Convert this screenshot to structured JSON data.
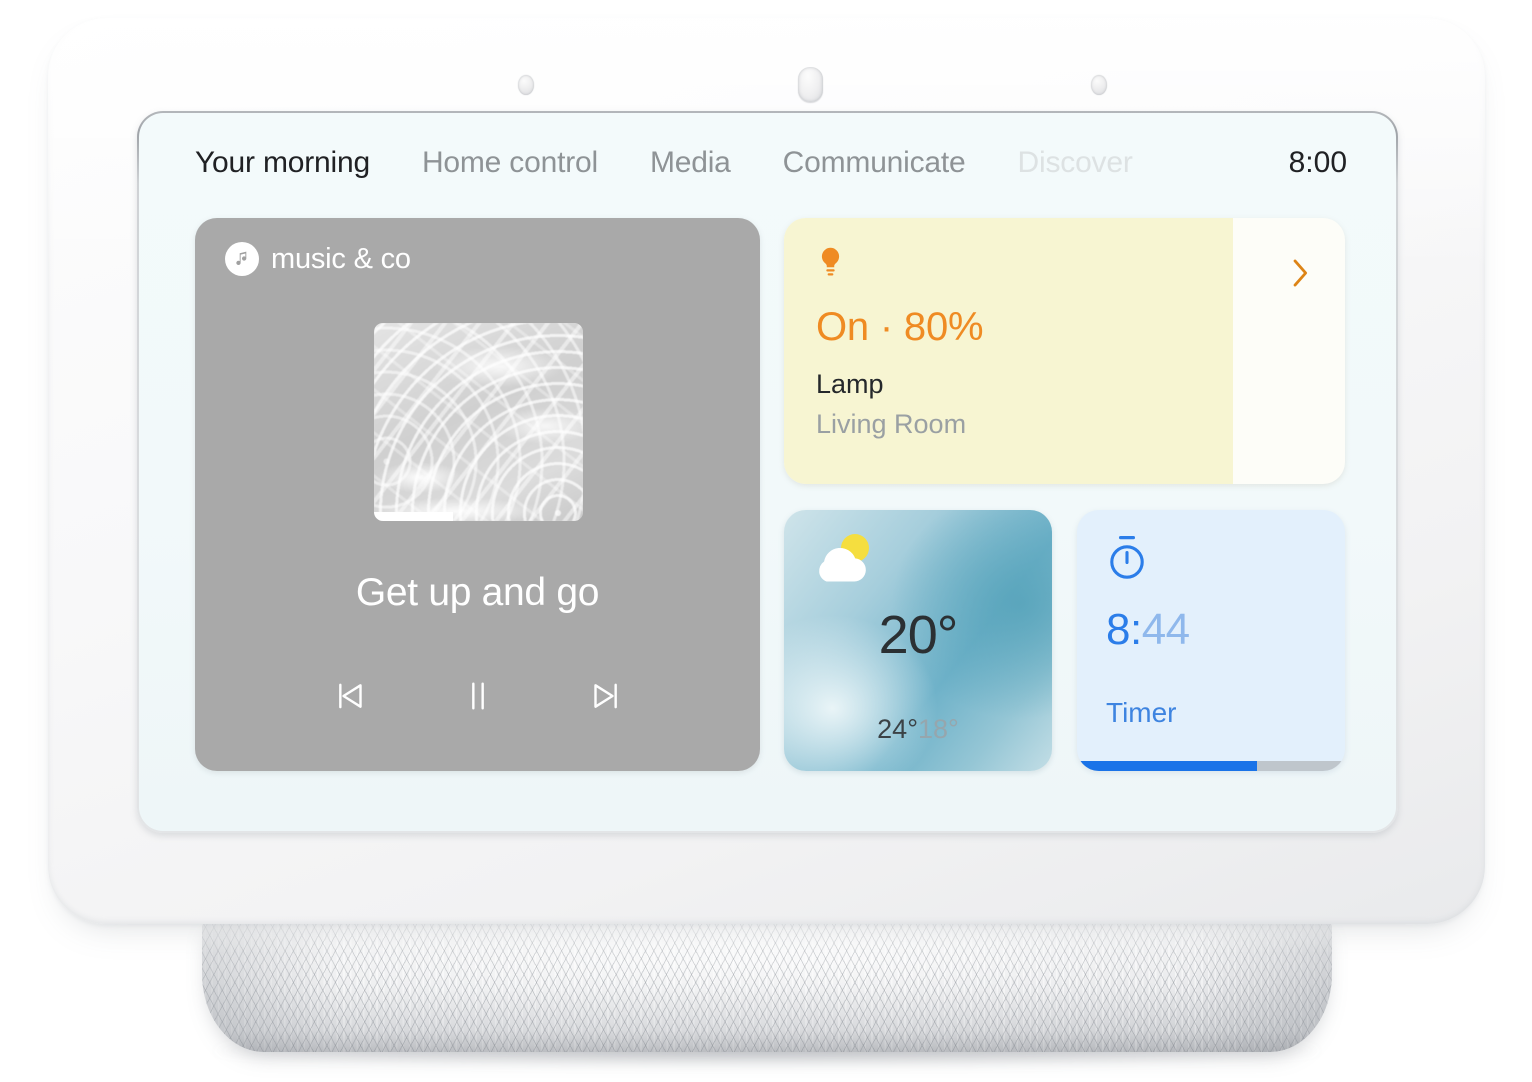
{
  "device": {
    "name": "smart-display",
    "sensors": [
      "proximity-sensor-left",
      "microphone-switch",
      "proximity-sensor-right"
    ]
  },
  "tabs": [
    {
      "label": "Your morning",
      "state": "active"
    },
    {
      "label": "Home control",
      "state": "inactive"
    },
    {
      "label": "Media",
      "state": "inactive"
    },
    {
      "label": "Communicate",
      "state": "inactive"
    },
    {
      "label": "Discover",
      "state": "faded"
    }
  ],
  "clock": "8:00",
  "media_card": {
    "provider": "music & co",
    "provider_icon": "music-note-icon",
    "track_title": "Get up and go",
    "album_art": "water-ripple-artwork",
    "progress_percent": 38,
    "controls": [
      {
        "name": "previous",
        "icon": "skip-previous-icon"
      },
      {
        "name": "pause",
        "icon": "pause-icon"
      },
      {
        "name": "next",
        "icon": "skip-next-icon"
      }
    ],
    "background_color": "#a9a9a9"
  },
  "lamp_card": {
    "icon": "lightbulb-icon",
    "status": "On · 80%",
    "brightness_percent": 80,
    "device_name": "Lamp",
    "room": "Living Room",
    "chevron": "chevron-right-icon",
    "accent_color": "#ef8b23",
    "fill_color": "#f7f5d2",
    "background_color": "#fdfdf8"
  },
  "weather_card": {
    "icon": "partly-cloudy-icon",
    "temperature": "20°",
    "high": "24°",
    "low": "18°"
  },
  "timer_card": {
    "icon": "timer-icon",
    "elapsed": "8:",
    "remaining": "44",
    "label": "Timer",
    "progress_percent": 67,
    "accent_color": "#1a73e8",
    "background_color": "#e3f0fc"
  }
}
